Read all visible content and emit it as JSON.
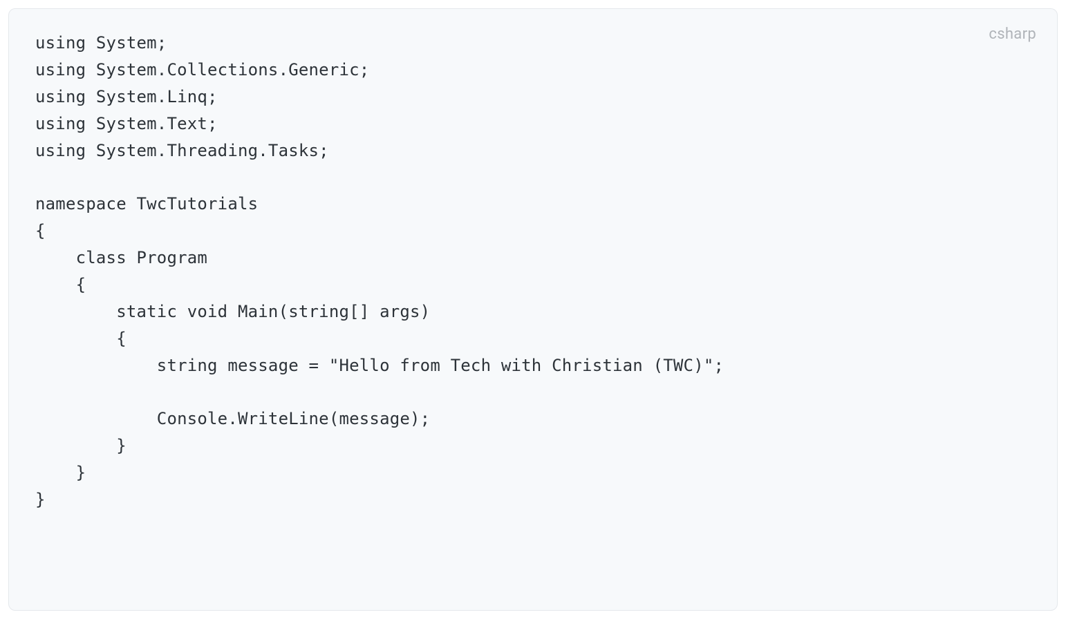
{
  "language_label": "csharp",
  "code": "using System;\nusing System.Collections.Generic;\nusing System.Linq;\nusing System.Text;\nusing System.Threading.Tasks;\n\nnamespace TwcTutorials\n{\n    class Program\n    {\n        static void Main(string[] args)\n        {\n            string message = \"Hello from Tech with Christian (TWC)\";\n\n            Console.WriteLine(message);\n        }\n    }\n}"
}
